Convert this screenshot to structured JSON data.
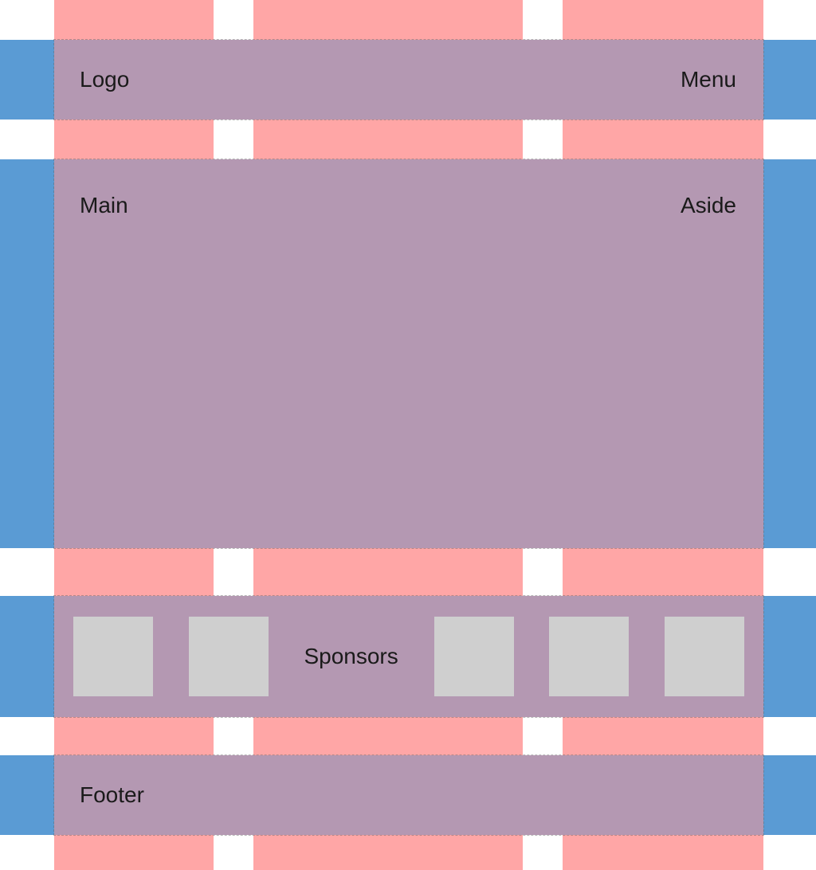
{
  "header": {
    "logo_label": "Logo",
    "menu_label": "Menu"
  },
  "content": {
    "main_label": "Main",
    "aside_label": "Aside"
  },
  "sponsors": {
    "label": "Sponsors"
  },
  "footer": {
    "label": "Footer"
  }
}
